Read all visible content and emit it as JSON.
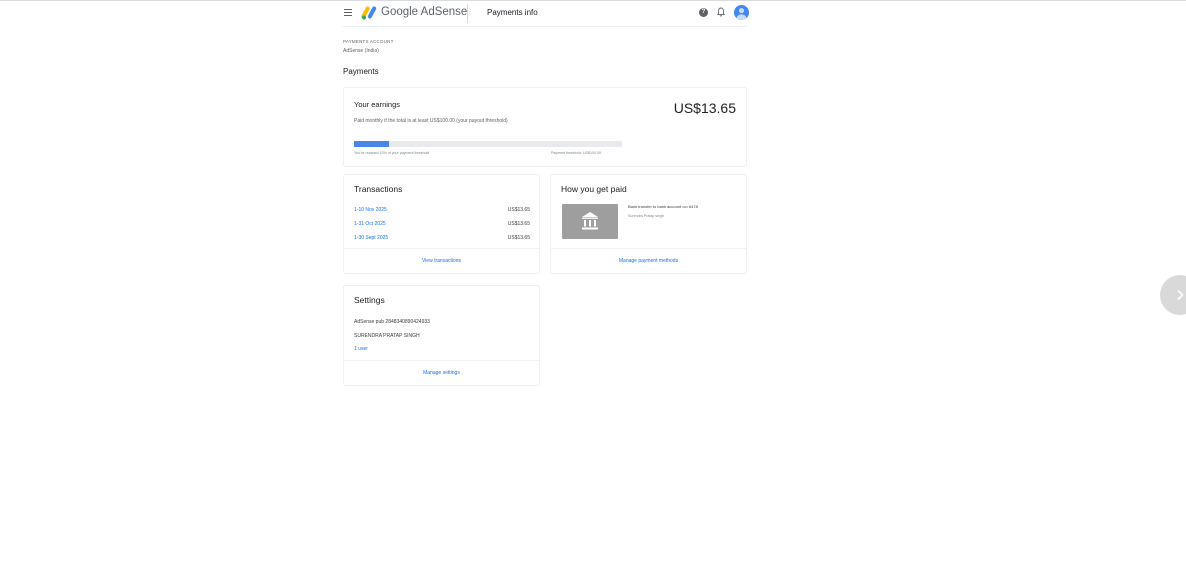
{
  "header": {
    "brand": "Google AdSense",
    "page_title": "Payments info",
    "help_glyph": "?",
    "icons": [
      "menu-icon",
      "adsense-logo",
      "help-icon",
      "bell-icon",
      "avatar"
    ]
  },
  "account": {
    "label": "PAYMENTS ACCOUNT",
    "value": "AdSense (India)"
  },
  "section_title": "Payments",
  "earnings": {
    "title": "Your earnings",
    "amount": "US$13.65",
    "subtitle": "Paid monthly if the total is at least US$100.00 (your payout threshold)",
    "progress_fraction": 0.13,
    "reached_text": "You've reached 13% of your payment threshold",
    "threshold_text": "Payment threshold: US$100.00"
  },
  "transactions": {
    "title": "Transactions",
    "rows": [
      {
        "period": "1-10 Nov 2025",
        "amount": "US$13.65"
      },
      {
        "period": "1-31 Oct 2025",
        "amount": "US$13.65"
      },
      {
        "period": "1-30 Sept 2025",
        "amount": "US$13.65"
      }
    ],
    "footer_link": "View transactions"
  },
  "payment_method": {
    "title": "How you get paid",
    "method_text": "Bank transfer to bank account •••• 6478",
    "holder_name": "Surendra Pratap singh",
    "icon": "bank-icon",
    "footer_link": "Manage payment methods"
  },
  "settings": {
    "title": "Settings",
    "publisher_id": "AdSense pub 2848340890424933",
    "account_name": "SURENDRA PRATAP SINGH",
    "users_link": "1 user",
    "footer_link": "Manage settings"
  },
  "colors": {
    "accent": "#1a73e8",
    "progress_fill": "#4a86e8",
    "bank_tile": "#9e9e9e"
  }
}
